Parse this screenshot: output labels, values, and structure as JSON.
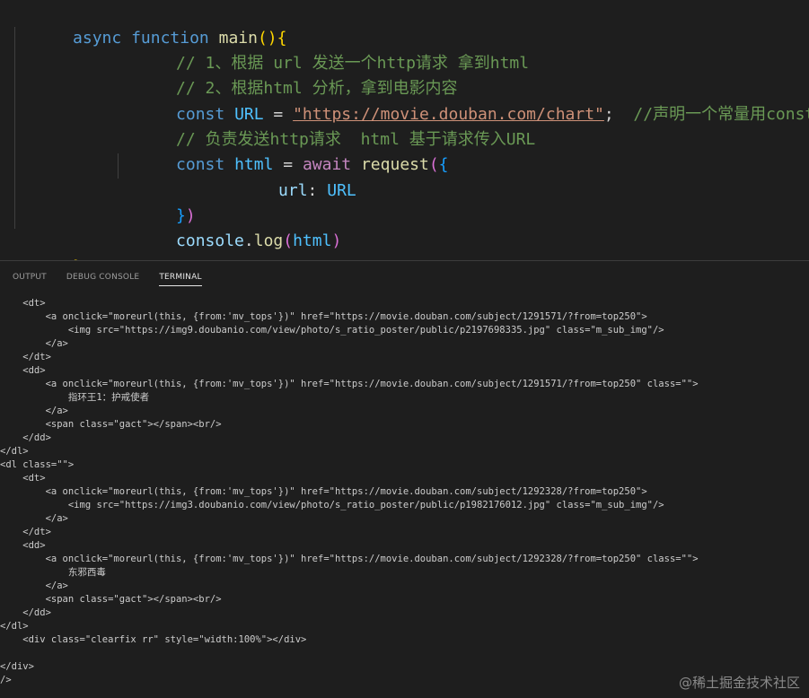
{
  "editor": {
    "line1": {
      "kw1": "async",
      "kw2": "function",
      "fn": "main",
      "paren": "()",
      "brace": "{"
    },
    "line2": {
      "comment": "// 1、根据 url 发送一个http请求 拿到html"
    },
    "line3": {
      "comment": "// 2、根据html 分析，拿到电影内容"
    },
    "line4": {
      "kw": "const",
      "name": "URL",
      "eq": " = ",
      "string": "\"https://movie.douban.com/chart\"",
      "semi": ";",
      "comment": "//声明一个常量用const"
    },
    "line5": {
      "comment": "// 负责发送http请求  html 基于请求传入URL"
    },
    "line6": {
      "kw": "const",
      "name": "html",
      "eq": " = ",
      "await": "await",
      "fn": "request",
      "paren": "(",
      "brace": "{"
    },
    "line7": {
      "prop": "url",
      "colon": ": ",
      "value": "URL"
    },
    "line8": {
      "brace": "}",
      "paren": ")"
    },
    "line9": {
      "obj": "console",
      "dot": ".",
      "fn": "log",
      "paren_open": "(",
      "arg": "html",
      "paren_close": ")"
    },
    "line10": {
      "brace": "}"
    }
  },
  "panel": {
    "tabs": [
      {
        "label": "OUTPUT"
      },
      {
        "label": "DEBUG CONSOLE"
      },
      {
        "label": "TERMINAL"
      }
    ]
  },
  "terminal": {
    "lines": [
      "    <dt>",
      "        <a onclick=\"moreurl(this, {from:'mv_tops'})\" href=\"https://movie.douban.com/subject/1291571/?from=top250\">",
      "            <img src=\"https://img9.doubanio.com/view/photo/s_ratio_poster/public/p2197698335.jpg\" class=\"m_sub_img\"/>",
      "        </a>",
      "    </dt>",
      "    <dd>",
      "        <a onclick=\"moreurl(this, {from:'mv_tops'})\" href=\"https://movie.douban.com/subject/1291571/?from=top250\" class=\"\">",
      "            指环王1：护戒使者",
      "        </a>",
      "        <span class=\"gact\"></span><br/>",
      "    </dd>",
      "</dl>",
      "<dl class=\"\">",
      "    <dt>",
      "        <a onclick=\"moreurl(this, {from:'mv_tops'})\" href=\"https://movie.douban.com/subject/1292328/?from=top250\">",
      "            <img src=\"https://img3.doubanio.com/view/photo/s_ratio_poster/public/p1982176012.jpg\" class=\"m_sub_img\"/>",
      "        </a>",
      "    </dt>",
      "    <dd>",
      "        <a onclick=\"moreurl(this, {from:'mv_tops'})\" href=\"https://movie.douban.com/subject/1292328/?from=top250\" class=\"\">",
      "            东邪西毒",
      "        </a>",
      "        <span class=\"gact\"></span><br/>",
      "    </dd>",
      "</dl>",
      "    <div class=\"clearfix rr\" style=\"width:100%\"></div>",
      "",
      "</div>",
      "/>"
    ]
  },
  "watermark": {
    "text": "@稀土掘金技术社区"
  }
}
